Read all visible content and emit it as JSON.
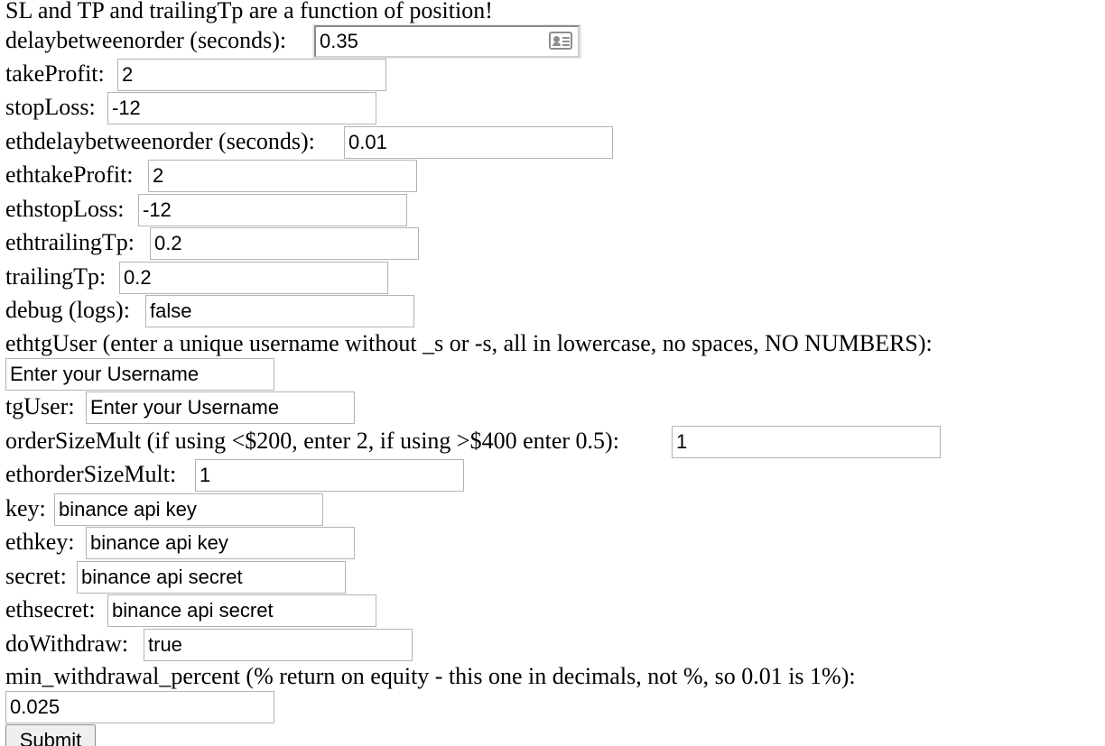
{
  "heading": "SL and TP and trailingTp are a function of position!",
  "fields": {
    "delaybetweenorder": {
      "label": "delaybetweenorder (seconds):",
      "value": "0.35"
    },
    "takeProfit": {
      "label": "takeProfit:",
      "value": "2"
    },
    "stopLoss": {
      "label": "stopLoss:",
      "value": "-12"
    },
    "ethdelaybetweenorder": {
      "label": "ethdelaybetweenorder (seconds):",
      "value": "0.01"
    },
    "ethtakeProfit": {
      "label": "ethtakeProfit:",
      "value": "2"
    },
    "ethstopLoss": {
      "label": "ethstopLoss:",
      "value": "-12"
    },
    "ethtrailingTp": {
      "label": "ethtrailingTp:",
      "value": "0.2"
    },
    "trailingTp": {
      "label": "trailingTp:",
      "value": "0.2"
    },
    "debug": {
      "label": "debug (logs):",
      "value": "false"
    },
    "ethtgUser": {
      "label": "ethtgUser (enter a unique username without _s or -s, all in lowercase, no spaces, NO NUMBERS):",
      "placeholder": "Enter your Username"
    },
    "tgUser": {
      "label": "tgUser:",
      "placeholder": "Enter your Username"
    },
    "orderSizeMult": {
      "label": "orderSizeMult (if using <$200, enter 2, if using >$400 enter 0.5):",
      "value": "1"
    },
    "ethorderSizeMult": {
      "label": "ethorderSizeMult:",
      "value": "1"
    },
    "key": {
      "label": "key:",
      "value": "binance api key"
    },
    "ethkey": {
      "label": "ethkey:",
      "value": "binance api key"
    },
    "secret": {
      "label": "secret:",
      "value": "binance api secret"
    },
    "ethsecret": {
      "label": "ethsecret:",
      "value": "binance api secret"
    },
    "doWithdraw": {
      "label": "doWithdraw:",
      "value": "true"
    },
    "min_withdrawal_percent": {
      "label": "min_withdrawal_percent (% return on equity - this one in decimals, not %, so 0.01 is 1%):",
      "value": "0.025"
    }
  },
  "submit": {
    "label": "Submit"
  },
  "icons": {
    "autofill": "contact-card-icon"
  }
}
